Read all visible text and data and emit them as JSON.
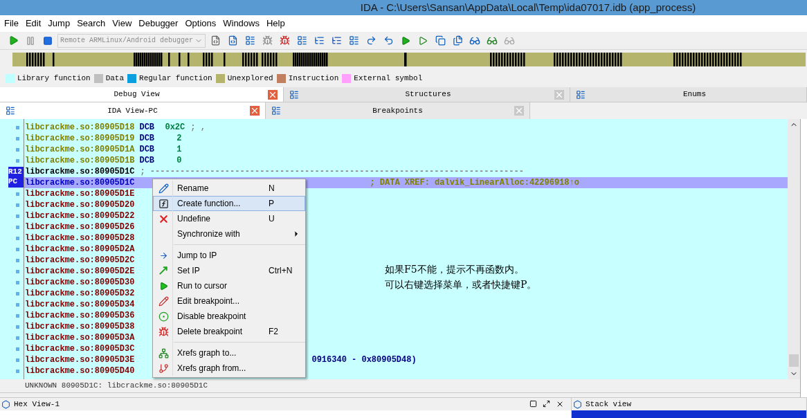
{
  "window": {
    "title": "IDA - C:\\Users\\Sansan\\AppData\\Local\\Temp\\ida07017.idb (app_process)"
  },
  "menu_bar": [
    "File",
    "Edit",
    "Jump",
    "Search",
    "View",
    "Debugger",
    "Options",
    "Windows",
    "Help"
  ],
  "toolbar": {
    "debugger_select": {
      "value": "Remote ARMLinux/Android debugger",
      "disabled": true
    }
  },
  "legend": [
    {
      "label": "Library function",
      "color": "#c0ffff"
    },
    {
      "label": "Data",
      "color": "#c0c0c0"
    },
    {
      "label": "Regular function",
      "color": "#0aa0e0"
    },
    {
      "label": "Unexplored",
      "color": "#b4b46c"
    },
    {
      "label": "Instruction",
      "color": "#c08060"
    },
    {
      "label": "External symbol",
      "color": "#ffa0ff"
    }
  ],
  "tabs_top": [
    {
      "label": "Debug View",
      "selected": true,
      "closable": true
    },
    {
      "label": "Structures",
      "selected": false,
      "closable": true
    },
    {
      "label": "Enums",
      "selected": false,
      "closable": false
    }
  ],
  "tabs_second": [
    {
      "label": "IDA View-PC",
      "selected": true
    },
    {
      "label": "Breakpoints",
      "selected": false
    }
  ],
  "register_badge": [
    "R12",
    "PC"
  ],
  "listing": [
    {
      "address": "libcrackme.so:80905D18",
      "kind": "data",
      "mnemonic": "DCB",
      "operand": "0x2C",
      "comment": "; ,"
    },
    {
      "address": "libcrackme.so:80905D19",
      "kind": "data",
      "mnemonic": "DCB",
      "operand": "2"
    },
    {
      "address": "libcrackme.so:80905D1A",
      "kind": "data",
      "mnemonic": "DCB",
      "operand": "1"
    },
    {
      "address": "libcrackme.so:80905D1B",
      "kind": "data",
      "mnemonic": "DCB",
      "operand": "0"
    },
    {
      "address": "libcrackme.so:80905D1C",
      "kind": "separator",
      "comment": "; ---------------------------------------------------------------------------"
    },
    {
      "address": "libcrackme.so:80905D1C",
      "kind": "current",
      "comment": "; DATA XREF: dalvik_LinearAlloc:42296918↑o"
    },
    {
      "address": "libcrackme.so:80905D1E",
      "kind": "code"
    },
    {
      "address": "libcrackme.so:80905D20",
      "kind": "code"
    },
    {
      "address": "libcrackme.so:80905D22",
      "kind": "code"
    },
    {
      "address": "libcrackme.so:80905D26",
      "kind": "code"
    },
    {
      "address": "libcrackme.so:80905D28",
      "kind": "code"
    },
    {
      "address": "libcrackme.so:80905D2A",
      "kind": "code"
    },
    {
      "address": "libcrackme.so:80905D2C",
      "kind": "code"
    },
    {
      "address": "libcrackme.so:80905D2E",
      "kind": "code"
    },
    {
      "address": "libcrackme.so:80905D30",
      "kind": "code"
    },
    {
      "address": "libcrackme.so:80905D32",
      "kind": "code"
    },
    {
      "address": "libcrackme.so:80905D34",
      "kind": "code"
    },
    {
      "address": "libcrackme.so:80905D36",
      "kind": "code"
    },
    {
      "address": "libcrackme.so:80905D38",
      "kind": "code"
    },
    {
      "address": "libcrackme.so:80905D3A",
      "kind": "code"
    },
    {
      "address": "libcrackme.so:80905D3C",
      "kind": "code"
    },
    {
      "address": "libcrackme.so:80905D3E",
      "kind": "code",
      "tail": "0916340 - 0x80905D48)"
    },
    {
      "address": "libcrackme.so:80905D40",
      "kind": "code"
    }
  ],
  "note": [
    "如果F5不能，提示不再函数内。",
    "可以右键选择菜单，或者快捷键P。"
  ],
  "status_line": "UNKNOWN 80905D1C: libcrackme.so:80905D1C",
  "context_menu": [
    {
      "label": "Rename",
      "shortcut": "N",
      "selected": false,
      "submenu": false,
      "separator_before": false
    },
    {
      "label": "Create function...",
      "shortcut": "P",
      "selected": true,
      "submenu": false,
      "separator_before": false
    },
    {
      "label": "Undefine",
      "shortcut": "U",
      "selected": false,
      "submenu": false,
      "separator_before": false
    },
    {
      "label": "Synchronize with",
      "selected": false,
      "submenu": true,
      "separator_before": false
    },
    {
      "label": "Jump to IP",
      "selected": false,
      "submenu": false,
      "separator_before": true
    },
    {
      "label": "Set IP",
      "shortcut": "Ctrl+N",
      "selected": false,
      "submenu": false,
      "separator_before": false
    },
    {
      "label": "Run to cursor",
      "selected": false,
      "submenu": false,
      "separator_before": false
    },
    {
      "label": "Edit breakpoint...",
      "selected": false,
      "submenu": false,
      "separator_before": false
    },
    {
      "label": "Disable breakpoint",
      "selected": false,
      "submenu": false,
      "separator_before": false
    },
    {
      "label": "Delete breakpoint",
      "shortcut": "F2",
      "selected": false,
      "submenu": false,
      "separator_before": false
    },
    {
      "label": "Xrefs graph to...",
      "selected": false,
      "submenu": false,
      "separator_before": true
    },
    {
      "label": "Xrefs graph from...",
      "selected": false,
      "submenu": false,
      "separator_before": false
    }
  ],
  "bottom_panes": [
    {
      "title": "Hex View-1"
    },
    {
      "title": "Stack view"
    }
  ]
}
